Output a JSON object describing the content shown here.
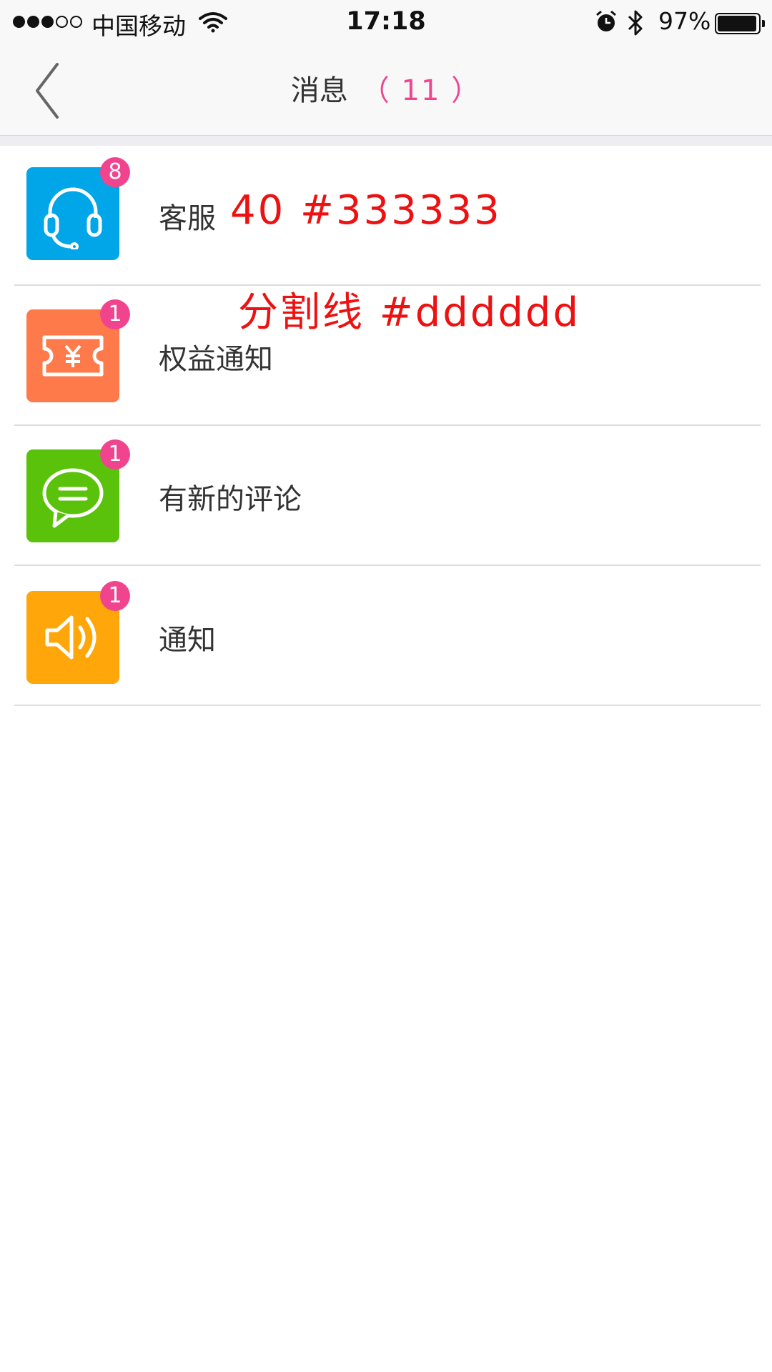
{
  "status_bar": {
    "carrier": "中国移动",
    "time": "17:18",
    "battery": "97%",
    "battery_level": 0.97,
    "signal_bars_filled": 3,
    "signal_bars_total": 5,
    "icons": [
      "wifi-icon",
      "alarm-icon",
      "bluetooth-icon",
      "battery-icon"
    ]
  },
  "nav": {
    "title": "消息",
    "count": "（ 11 ）",
    "back_icon": "chevron-left-icon"
  },
  "items": [
    {
      "label": "客服",
      "badge": "8",
      "icon": "headset-icon",
      "color": "#00a6e8"
    },
    {
      "label": "权益通知",
      "badge": "1",
      "icon": "ticket-yen-icon",
      "color": "#ff7a4a"
    },
    {
      "label": "有新的评论",
      "badge": "1",
      "icon": "comment-icon",
      "color": "#5ac20a"
    },
    {
      "label": "通知",
      "badge": "1",
      "icon": "speaker-icon",
      "color": "#ffa70a"
    }
  ],
  "annotations": {
    "font_note": "40   #333333",
    "divider_note": "分割线   #dddddd"
  },
  "colors": {
    "accent": "#f0458e",
    "text": "#333333",
    "divider": "#dddddd",
    "annotation": "#ee1111"
  }
}
